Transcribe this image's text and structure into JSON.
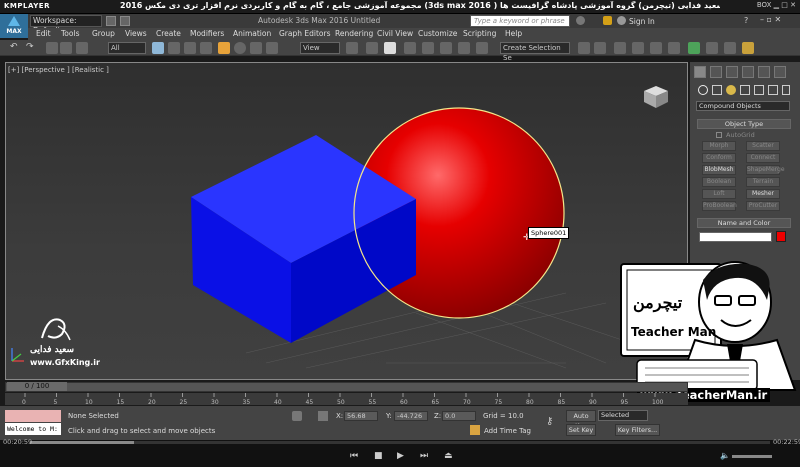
{
  "player": {
    "logo": "KMPLAYER",
    "title": "مجموعه آموزشی جامع ، گام به گام و کاربردی نرم افزار تری دی مکس 2016 (3ds max 2016 )  مدرس : سعید فدایی (تیچرمن) گروه آموزشی پادشاه گرافیست ها",
    "controls": "BOX",
    "time_current": "00:20:59",
    "time_total": "00:22:59",
    "progress": 0.14
  },
  "max": {
    "logo": "MAX",
    "workspace": "Workspace: Default",
    "app_title": "Autodesk 3ds Max 2016     Untitled",
    "search_placeholder": "Type a keyword or phrase",
    "sign_in": "Sign In"
  },
  "menu": [
    "Edit",
    "Tools",
    "Group",
    "Views",
    "Create",
    "Modifiers",
    "Animation",
    "Graph Editors",
    "Rendering",
    "Civil View",
    "Customize",
    "Scripting",
    "Help"
  ],
  "toolbar": {
    "filter": "All",
    "ref_coord": "View",
    "named_selection": "Create Selection Se"
  },
  "viewport": {
    "label": "[+] [Perspective ] [Realistic ]",
    "tooltip": "Sphere001",
    "box_color": "#0a10e6",
    "sphere_color": "#e60000"
  },
  "watermark": {
    "name": "سعید فدایی",
    "url": "www.GfxKing.ir"
  },
  "command_panel": {
    "dropdown": "Compound Objects",
    "object_type": "Object Type",
    "autogrid": "AutoGrid",
    "buttons": [
      "Morph",
      "Scatter",
      "Conform",
      "Connect",
      "BlobMesh",
      "ShapeMerge",
      "Boolean",
      "Terrain",
      "Loft",
      "Mesher",
      "ProBoolean",
      "ProCutter"
    ],
    "name_and_color": "Name and Color"
  },
  "overlay": {
    "brand": "Teacher Man",
    "url": "www.TeacherMan.ir"
  },
  "timeline": {
    "frame": "0 / 100",
    "ticks": [
      "0",
      "5",
      "10",
      "15",
      "20",
      "25",
      "30",
      "35",
      "40",
      "45",
      "50",
      "55",
      "60",
      "65",
      "70",
      "75",
      "80",
      "85",
      "90",
      "95",
      "100"
    ]
  },
  "status": {
    "none_selected": "None Selected",
    "hint": "Click and drag to select and move objects",
    "welcome": "Welcome to M:",
    "x_label": "X:",
    "x_value": "56.68",
    "y_label": "Y:",
    "y_value": "-44.726",
    "z_label": "Z:",
    "z_value": "0.0",
    "grid": "Grid = 10.0",
    "add_time_tag": "Add Time Tag",
    "auto_key": "Auto Key",
    "set_key": "Set Key",
    "selected": "Selected",
    "key_filters": "Key Filters..."
  }
}
